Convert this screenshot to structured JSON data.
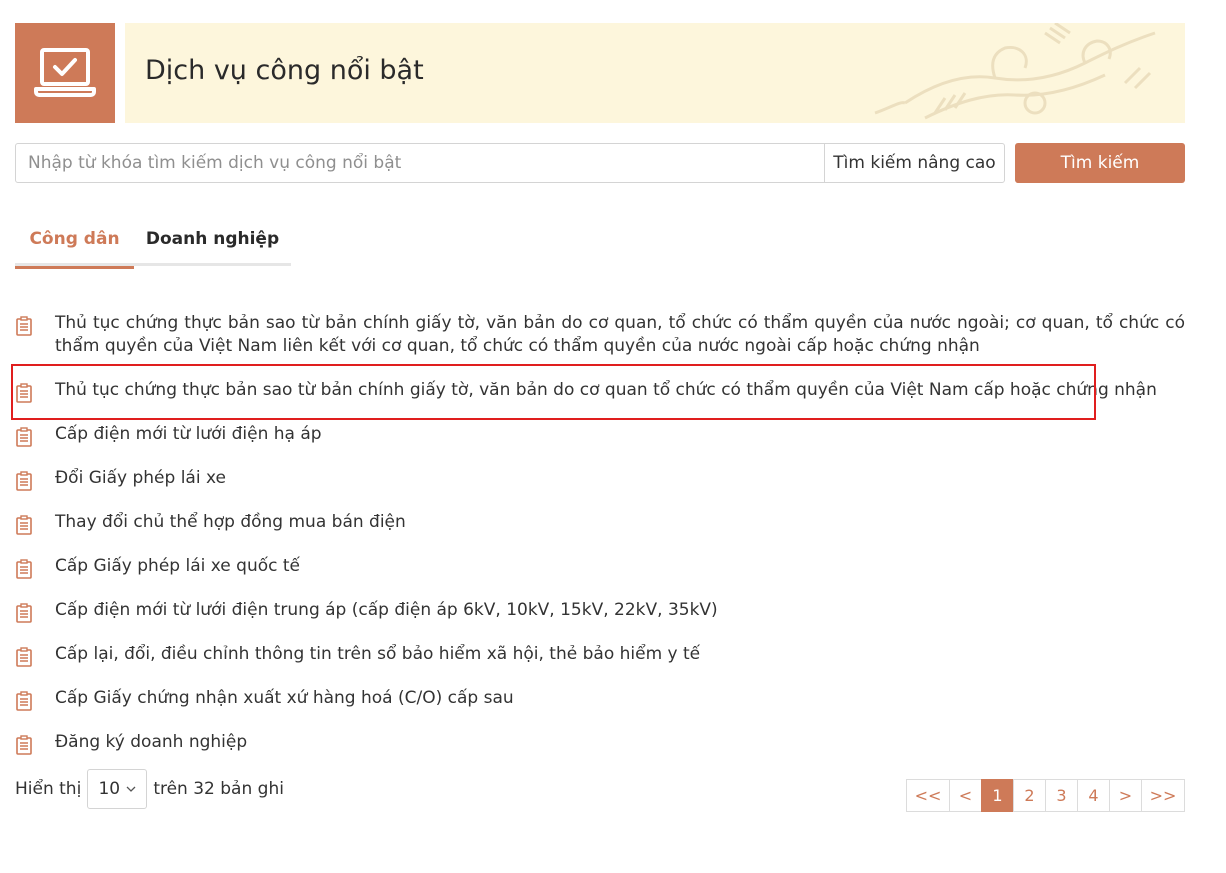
{
  "header": {
    "icon": "laptop-check-icon",
    "title": "Dịch vụ công nổi bật",
    "accent_color": "#ce7a58",
    "banner_color": "#fdf6dc"
  },
  "search": {
    "placeholder": "Nhập từ khóa tìm kiếm dịch vụ công nổi bật",
    "value": "",
    "advanced_label": "Tìm kiếm nâng cao",
    "submit_label": "Tìm kiếm"
  },
  "tabs": [
    {
      "label": "Công dân",
      "active": true
    },
    {
      "label": "Doanh nghiệp",
      "active": false
    }
  ],
  "services": [
    {
      "icon": "document-list-icon",
      "title": "Thủ tục chứng thực bản sao từ bản chính giấy tờ, văn bản do cơ quan, tổ chức có thẩm quyền của nước ngoài; cơ quan, tổ chức có thẩm quyền của Việt Nam liên kết với cơ quan, tổ chức có thẩm quyền của nước ngoài cấp hoặc chứng nhận"
    },
    {
      "icon": "document-list-icon",
      "title": "Thủ tục chứng thực bản sao từ bản chính giấy tờ, văn bản do cơ quan tổ chức có thẩm quyền của Việt Nam cấp hoặc chứng nhận",
      "highlighted": true
    },
    {
      "icon": "document-list-icon",
      "title": "Cấp điện mới từ lưới điện hạ áp"
    },
    {
      "icon": "document-list-icon",
      "title": "Đổi Giấy phép lái xe"
    },
    {
      "icon": "document-list-icon",
      "title": "Thay đổi chủ thể hợp đồng mua bán điện"
    },
    {
      "icon": "document-list-icon",
      "title": "Cấp Giấy phép lái xe quốc tế"
    },
    {
      "icon": "document-list-icon",
      "title": "Cấp điện mới từ lưới điện trung áp (cấp điện áp 6kV, 10kV, 15kV, 22kV, 35kV)"
    },
    {
      "icon": "document-list-icon",
      "title": "Cấp lại, đổi, điều chỉnh thông tin trên sổ bảo hiểm xã hội, thẻ bảo hiểm y tế"
    },
    {
      "icon": "document-list-icon",
      "title": "Cấp Giấy chứng nhận xuất xứ hàng hoá (C/O) cấp sau"
    },
    {
      "icon": "document-list-icon",
      "title": "Đăng ký doanh nghiệp"
    }
  ],
  "footer": {
    "show_label": "Hiển thị",
    "page_size": "10",
    "page_size_icon": "chevron-down-icon",
    "total_label": "trên 32 bản ghi"
  },
  "pagination": {
    "first": "<<",
    "prev": "<",
    "pages": [
      "1",
      "2",
      "3",
      "4"
    ],
    "current": "1",
    "next": ">",
    "last": ">>"
  }
}
